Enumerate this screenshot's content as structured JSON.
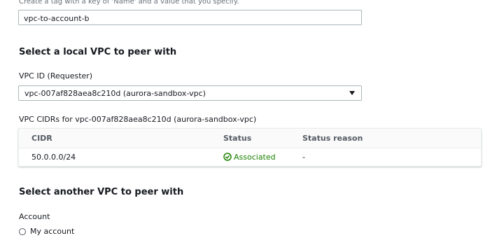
{
  "name_tag": {
    "hint": "Create a tag with a key of 'Name' and a value that you specify.",
    "value": "vpc-to-account-b"
  },
  "local_vpc": {
    "heading": "Select a local VPC to peer with",
    "vpc_id_label": "VPC ID (Requester)",
    "vpc_id_selected": "vpc-007af828aea8c210d (aurora-sandbox-vpc)",
    "cidrs_label": "VPC CIDRs for vpc-007af828aea8c210d (aurora-sandbox-vpc)",
    "table": {
      "columns": [
        "CIDR",
        "Status",
        "Status reason"
      ],
      "rows": [
        {
          "cidr": "50.0.0.0/24",
          "status": "Associated",
          "status_reason": "-"
        }
      ]
    }
  },
  "another_vpc": {
    "heading": "Select another VPC to peer with",
    "account_label": "Account",
    "account_options": [
      "My account"
    ]
  },
  "colors": {
    "success": "#1d8102",
    "border": "#aab7b8"
  },
  "icons": {
    "status": "check-circle-icon",
    "dropdown": "caret-down-icon"
  }
}
